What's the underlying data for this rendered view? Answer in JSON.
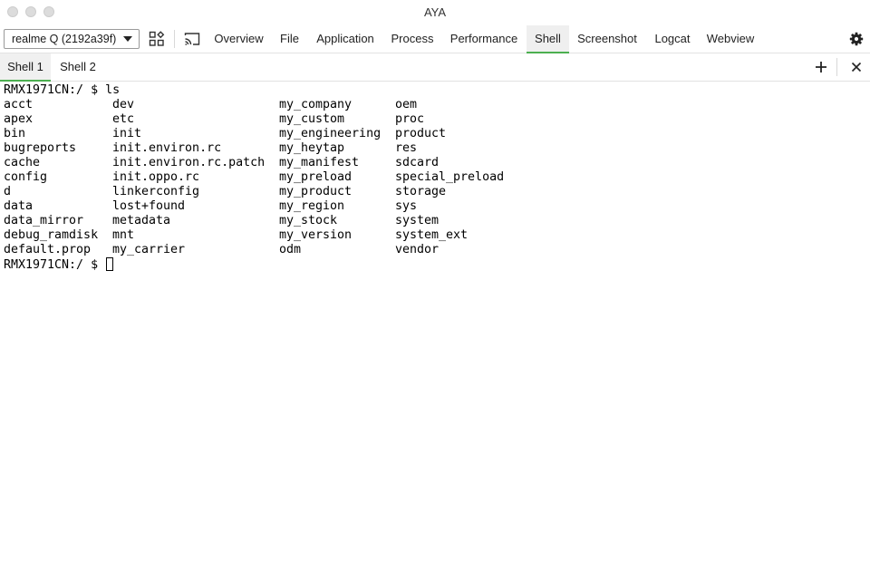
{
  "window": {
    "title": "AYA"
  },
  "toolbar": {
    "device_select": "realme Q (2192a39f)",
    "tabs": [
      {
        "label": "Overview"
      },
      {
        "label": "File"
      },
      {
        "label": "Application"
      },
      {
        "label": "Process"
      },
      {
        "label": "Performance"
      },
      {
        "label": "Shell"
      },
      {
        "label": "Screenshot"
      },
      {
        "label": "Logcat"
      },
      {
        "label": "Webview"
      }
    ],
    "active_tab": "Shell",
    "icons": [
      "apps-icon",
      "cast-icon",
      "gear-icon"
    ]
  },
  "shell_tabs": {
    "tabs": [
      {
        "label": "Shell 1"
      },
      {
        "label": "Shell 2"
      }
    ],
    "active": "Shell 1",
    "icons": [
      "plus-icon",
      "close-icon"
    ]
  },
  "terminal": {
    "prompt": "RMX1971CN:/ $ ",
    "command": "ls",
    "listing": [
      [
        "acct",
        "dev",
        "my_company",
        "oem"
      ],
      [
        "apex",
        "etc",
        "my_custom",
        "proc"
      ],
      [
        "bin",
        "init",
        "my_engineering",
        "product"
      ],
      [
        "bugreports",
        "init.environ.rc",
        "my_heytap",
        "res"
      ],
      [
        "cache",
        "init.environ.rc.patch",
        "my_manifest",
        "sdcard"
      ],
      [
        "config",
        "init.oppo.rc",
        "my_preload",
        "special_preload"
      ],
      [
        "d",
        "linkerconfig",
        "my_product",
        "storage"
      ],
      [
        "data",
        "lost+found",
        "my_region",
        "sys"
      ],
      [
        "data_mirror",
        "metadata",
        "my_stock",
        "system"
      ],
      [
        "debug_ramdisk",
        "mnt",
        "my_version",
        "system_ext"
      ],
      [
        "default.prop",
        "my_carrier",
        "odm",
        "vendor"
      ]
    ]
  }
}
